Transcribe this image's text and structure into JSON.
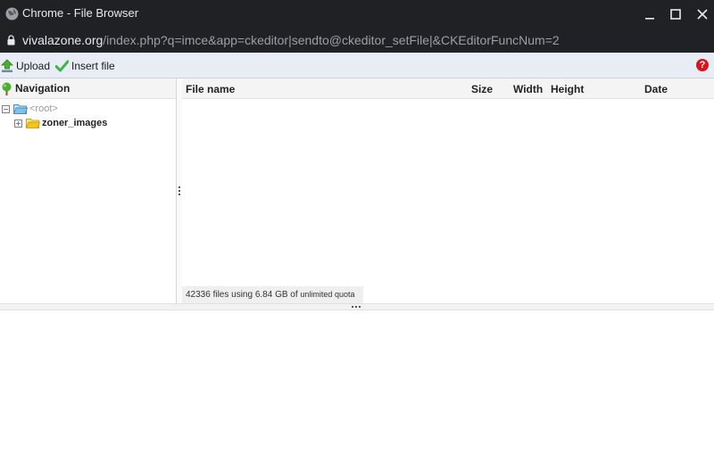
{
  "window": {
    "title": "Chrome - File Browser",
    "url_host": "vivalazone.org",
    "url_path": "/index.php?q=imce&app=ckeditor|sendto@ckeditor_setFile|&CKEditorFuncNum=2"
  },
  "toolbar": {
    "upload_label": "Upload",
    "insert_label": "Insert file",
    "help_label": "?"
  },
  "navigation": {
    "title": "Navigation",
    "root_label": "<root>",
    "root_toggle": "−",
    "folders": [
      {
        "label": "zoner_images",
        "toggle": "+"
      }
    ]
  },
  "files": {
    "columns": {
      "name": "File name",
      "size": "Size",
      "width": "Width",
      "height": "Height",
      "date": "Date"
    },
    "rows": [],
    "status": {
      "prefix": "42336 files using 6.84 GB of",
      "quota": "unlimited quota"
    }
  },
  "colors": {
    "titlebar": "#202124",
    "toolbar": "#e8ecf5",
    "help_badge": "#d8141e",
    "folder": "#f5c518"
  }
}
